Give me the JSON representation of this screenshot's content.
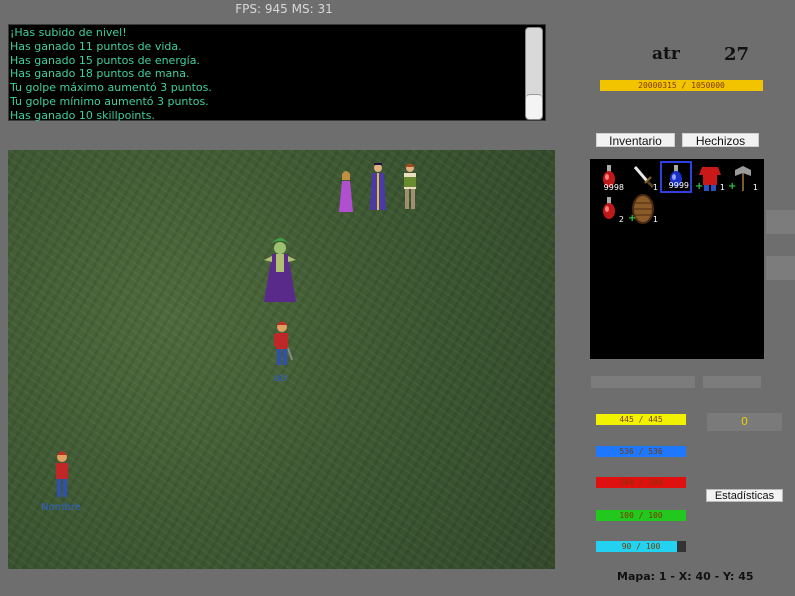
{
  "header": {
    "fps_text": "FPS: 945   MS: 31"
  },
  "console": {
    "lines": [
      "¡Has subido de nivel!",
      "Has ganado 11 puntos de vida.",
      "Has ganado 15 puntos de energía.",
      "Has ganado 18 puntos de mana.",
      "Tu golpe máximo aumentó 3 puntos.",
      "Tu golpe mínimo aumentó 3 puntos.",
      "Has ganado 10 skillpoints."
    ]
  },
  "player": {
    "name": "atr",
    "level": "27",
    "exp_text": "20000315  /  1050000",
    "exp_fraction": 1.0
  },
  "tabs": {
    "inventory_label": "Inventario",
    "spells_label": "Hechizos"
  },
  "inventory": {
    "items": [
      {
        "icon": "red-potion-icon",
        "qty": "9998",
        "equipped": ""
      },
      {
        "icon": "dagger-icon",
        "qty": "1",
        "equipped": ""
      },
      {
        "icon": "blue-potion-icon",
        "qty": "9999",
        "equipped": "",
        "selected": true
      },
      {
        "icon": "red-tunic-icon",
        "qty": "1",
        "equipped": "+"
      },
      {
        "icon": "axe-icon",
        "qty": "1",
        "equipped": "+"
      },
      {
        "icon": "red-potion-icon",
        "qty": "2",
        "equipped": ""
      },
      {
        "icon": "wooden-shield-icon",
        "qty": "1",
        "equipped": "+"
      }
    ]
  },
  "gold": "0",
  "stats": {
    "stamina": {
      "text": "445  /  445",
      "fraction": 1.0,
      "color": "#f2f200"
    },
    "mana": {
      "text": "536  /  536",
      "fraction": 1.0,
      "color": "#1e78ff"
    },
    "health": {
      "text": "204  /  204",
      "fraction": 1.0,
      "color": "#e01010"
    },
    "hunger": {
      "text": "100  /  100",
      "fraction": 1.0,
      "color": "#22c81e"
    },
    "thirst": {
      "text": "90  /  100",
      "fraction": 0.9,
      "color": "#22d2f0"
    }
  },
  "buttons": {
    "stats_label": "Estadísticas"
  },
  "map_info": "Mapa: 1 - X: 40 - Y: 45",
  "characters": [
    {
      "id": "player",
      "label": "atr"
    },
    {
      "id": "npc",
      "label": "Nombre"
    }
  ]
}
